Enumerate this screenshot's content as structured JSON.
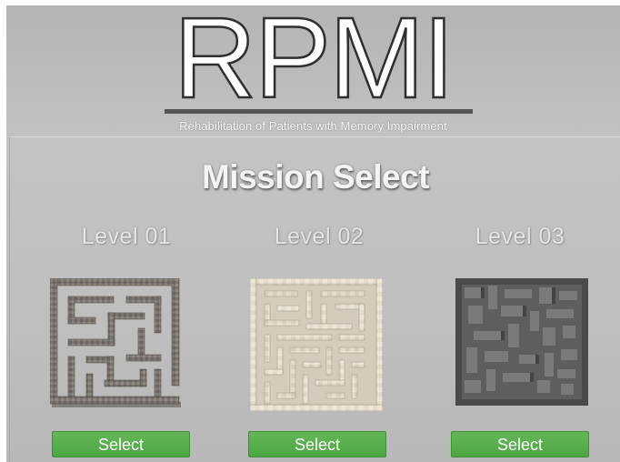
{
  "header": {
    "logo_text": "RPMI",
    "subtitle": "Rehabilitation of Patients with Memory Impairment"
  },
  "panel": {
    "title": "Mission Select"
  },
  "levels": [
    {
      "label": "Level 01",
      "button": "Select",
      "maze_style": "stone-grey"
    },
    {
      "label": "Level 02",
      "button": "Select",
      "maze_style": "marble-cream"
    },
    {
      "label": "Level 03",
      "button": "Select",
      "maze_style": "dark-grey-blocks"
    }
  ],
  "colors": {
    "button_green": "#56ad4b",
    "background_grey": "#bdbdbd"
  }
}
